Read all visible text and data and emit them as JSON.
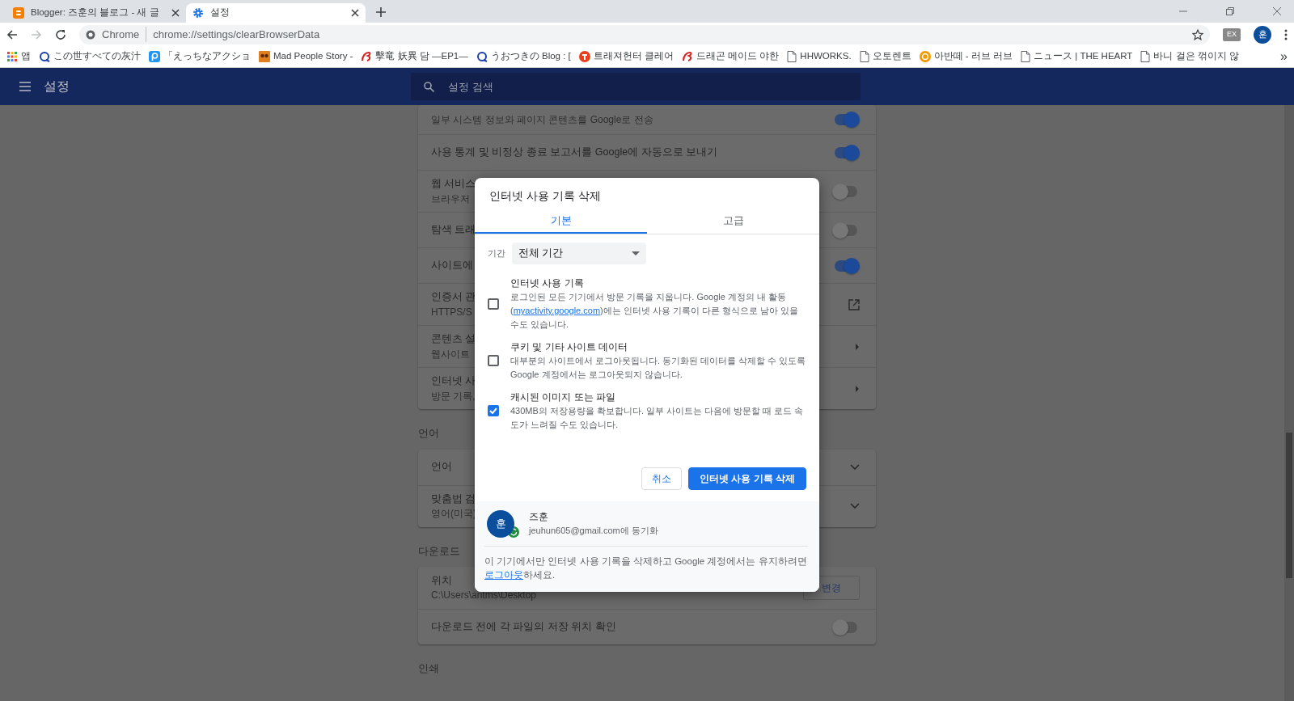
{
  "browser": {
    "tabs": [
      {
        "title": "Blogger: 즈훈의 블로그 - 새 글",
        "kind": "blogger",
        "selected": false
      },
      {
        "title": "설정",
        "kind": "settings",
        "selected": true
      }
    ],
    "address_bar": {
      "chip": "Chrome",
      "url": "chrome://settings/clearBrowserData"
    },
    "extension_label": "EX",
    "profile_initial": "훈",
    "bookmarks": [
      {
        "label": "앱",
        "kind": "apps"
      },
      {
        "label": "この世すべての灰汁",
        "kind": "ring"
      },
      {
        "label": "「えっちなアクショ",
        "kind": "square"
      },
      {
        "label": "Mad People Story -",
        "kind": "owl"
      },
      {
        "label": "擊竜 妖異 담 —EP1—",
        "kind": "dragon"
      },
      {
        "label": "うおつきの Blog : [",
        "kind": "ring"
      },
      {
        "label": "트래져헌터 클레어",
        "kind": "dot"
      },
      {
        "label": "드래곤 메이드 야한",
        "kind": "dragon"
      },
      {
        "label": "HHWORKS.",
        "kind": "page"
      },
      {
        "label": "오토렌트",
        "kind": "page"
      },
      {
        "label": "아반떼 - 러브 러브",
        "kind": "bubble"
      },
      {
        "label": "ニュース | THE HEART",
        "kind": "page"
      },
      {
        "label": "바니 걸은 꺾이지 않",
        "kind": "page"
      }
    ],
    "bookmarks_overflow": "»"
  },
  "settings_header": {
    "title": "설정",
    "search_placeholder": "설정 검색"
  },
  "sections": [
    {
      "rows": [
        {
          "subtitle": "일부 시스템 정보와 페이지 콘텐츠를 Google로 전송",
          "control": {
            "kind": "toggle",
            "on": true
          }
        },
        {
          "title": "사용 통계 및 비정상 종료 보고서를 Google에 자동으로 보내기",
          "control": {
            "kind": "toggle",
            "on": true
          }
        },
        {
          "title": "웹 서비스",
          "subtitle": "브라우저",
          "control": {
            "kind": "toggle",
            "on": false
          }
        },
        {
          "title": "탐색 트래",
          "control": {
            "kind": "toggle",
            "on": false
          }
        },
        {
          "title": "사이트에",
          "control": {
            "kind": "toggle",
            "on": true
          }
        },
        {
          "title": "인증서 관",
          "subtitle": "HTTPS/S",
          "control": {
            "kind": "external"
          }
        },
        {
          "title": "콘텐츠 설",
          "subtitle": "웹사이트",
          "control": {
            "kind": "arrow"
          }
        },
        {
          "title": "인터넷 사",
          "subtitle": "방문 기록,",
          "control": {
            "kind": "arrow"
          }
        }
      ]
    },
    {
      "heading": "언어",
      "rows": [
        {
          "title": "언어",
          "control": {
            "kind": "expand"
          }
        },
        {
          "title": "맞춤법 검",
          "subtitle": "영어(미국)",
          "control": {
            "kind": "expand"
          }
        }
      ]
    },
    {
      "heading": "다운로드",
      "rows": [
        {
          "title": "위치",
          "subtitle": "C:\\Users\\antms\\Desktop",
          "control": {
            "kind": "button",
            "label": "변경"
          }
        },
        {
          "title": "다운로드 전에 각 파일의 저장 위치 확인",
          "control": {
            "kind": "toggle",
            "on": false
          }
        }
      ]
    },
    {
      "heading": "인쇄"
    }
  ],
  "dialog": {
    "title": "인터넷 사용 기록 삭제",
    "tabs": [
      {
        "label": "기본",
        "selected": true
      },
      {
        "label": "고급",
        "selected": false
      }
    ],
    "period": {
      "label": "기간",
      "value": "전체 기간"
    },
    "options": [
      {
        "title": "인터넷 사용 기록",
        "checked": false,
        "description": [
          {
            "kind": "text",
            "text": "로그인된 모든 기기에서 방문 기록을 지웁니다. Google 계정의 내 활동 ("
          },
          {
            "kind": "link",
            "text": "myactivity.google.com"
          },
          {
            "kind": "text",
            "text": ")에는 인터넷 사용 기록이 다른 형식으로 남아 있을 수도 있습니다."
          }
        ]
      },
      {
        "title": "쿠키 및 기타 사이트 데이터",
        "checked": false,
        "description": [
          {
            "kind": "text",
            "text": "대부분의 사이트에서 로그아웃됩니다. 동기화된 데이터를 삭제할 수 있도록 Google 계정에서는 로그아웃되지 않습니다."
          }
        ]
      },
      {
        "title": "캐시된 이미지 또는 파일",
        "checked": true,
        "description": [
          {
            "kind": "text",
            "text": "430MB의 저장용량을 확보합니다. 일부 사이트는 다음에 방문할 때 로드 속도가 느려질 수도 있습니다."
          }
        ]
      }
    ],
    "buttons": [
      {
        "label": "취소",
        "kind": "secondary"
      },
      {
        "label": "인터넷 사용 기록 삭제",
        "kind": "primary"
      }
    ],
    "account": {
      "initial": "훈",
      "name": "즈훈",
      "sync": "jeuhun605@gmail.com에 동기화"
    },
    "note": [
      {
        "kind": "text",
        "text": "이 기기에서만 인터넷 사용 기록을 삭제하고 Google 계정에서는 유지하려면 "
      },
      {
        "kind": "link",
        "text": "로그아웃"
      },
      {
        "kind": "text",
        "text": "하세요."
      }
    ]
  }
}
